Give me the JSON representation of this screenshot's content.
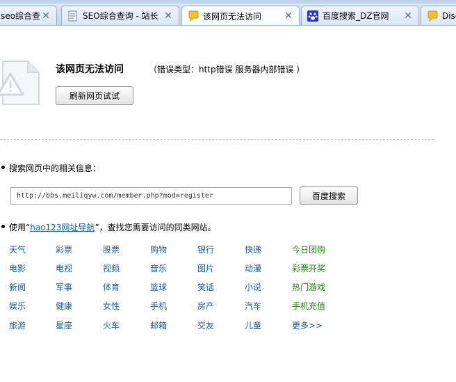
{
  "tabs": [
    {
      "label": "seo综合查",
      "icon": "page-icon",
      "active": false
    },
    {
      "label": "SEO综合查询 - 站长",
      "icon": "page-icon",
      "active": false
    },
    {
      "label": "该网页无法访问",
      "icon": "error-bubble-icon",
      "active": true
    },
    {
      "label": "百度搜索_DZ官网",
      "icon": "baidu-paw-icon",
      "active": false
    },
    {
      "label": "Disc",
      "icon": "error-bubble-icon",
      "active": false
    }
  ],
  "error": {
    "title": "该网页无法访问",
    "type_text": "（错误类型：http错误  服务器内部错误 ）",
    "refresh_label": "刷新网页试试"
  },
  "search": {
    "label": "搜索网页中的相关信息：",
    "url_value": "http://bbs.meiliqyw.com/member.php?mod=register",
    "button_label": "百度搜索"
  },
  "nav": {
    "prefix": "使用“",
    "link_text": "hao123网址导航",
    "suffix": "”，查找您需要访问的同类网站。"
  },
  "link_grid": [
    [
      "天气",
      "彩票",
      "股票",
      "购物",
      "银行",
      "快递",
      "今日团购"
    ],
    [
      "电影",
      "电视",
      "视频",
      "音乐",
      "图片",
      "动漫",
      "彩票开奖"
    ],
    [
      "新闻",
      "军事",
      "体育",
      "篮球",
      "笑话",
      "小说",
      "热门游戏"
    ],
    [
      "娱乐",
      "健康",
      "女性",
      "手机",
      "房产",
      "汽车",
      "手机充值"
    ],
    [
      "旅游",
      "星座",
      "火车",
      "邮箱",
      "交友",
      "儿童",
      "更多>>"
    ]
  ],
  "colors": {
    "link_blue": "#1a5d9c",
    "link_green": "#238a10",
    "nav_link": "#0b61b2"
  }
}
